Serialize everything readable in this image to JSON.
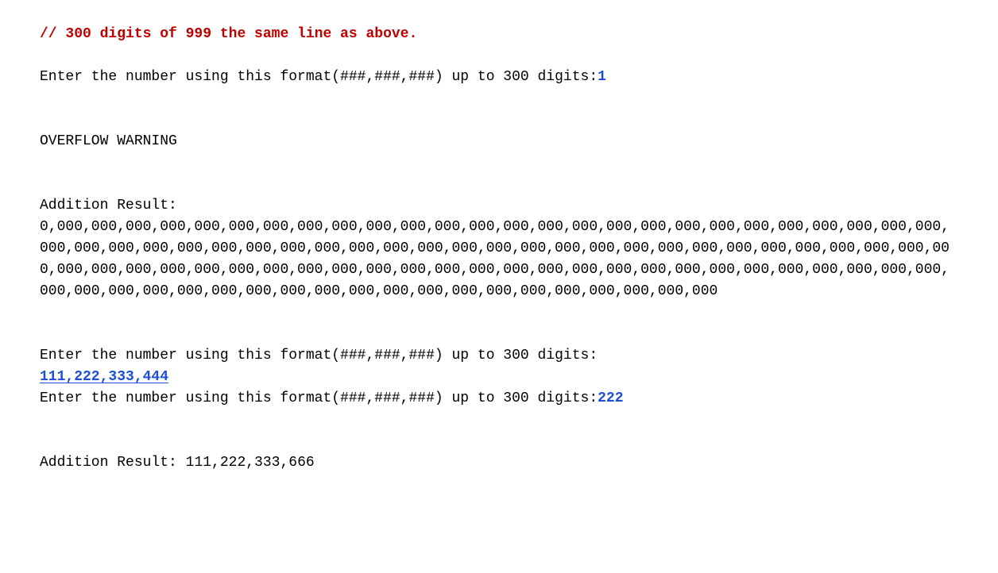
{
  "comment": "// 300 digits of 999 the same line as above.",
  "prompt1": {
    "label": "Enter the number using this format(###,###,###) up to 300 digits:",
    "input": "1"
  },
  "warning": "OVERFLOW WARNING",
  "result1": {
    "label": "Addition Result:",
    "value": "0,000,000,000,000,000,000,000,000,000,000,000,000,000,000,000,000,000,000,000,000,000,000,000,000,000,000,000,000,000,000,000,000,000,000,000,000,000,000,000,000,000,000,000,000,000,000,000,000,000,000,000,000,000,000,000,000,000,000,000,000,000,000,000,000,000,000,000,000,000,000,000,000,000,000,000,000,000,000,000,000,000,000,000,000,000,000,000,000,000,000,000,000,000,000,000,000,000,000,000"
  },
  "prompt2": {
    "label": "Enter the number using this format(###,###,###) up to 300 digits:",
    "input": "111,222,333,444"
  },
  "prompt3": {
    "label": "Enter the number using this format(###,###,###) up to 300 digits:",
    "input": "222"
  },
  "result2": {
    "label": "Addition Result: ",
    "value": "111,222,333,666"
  }
}
